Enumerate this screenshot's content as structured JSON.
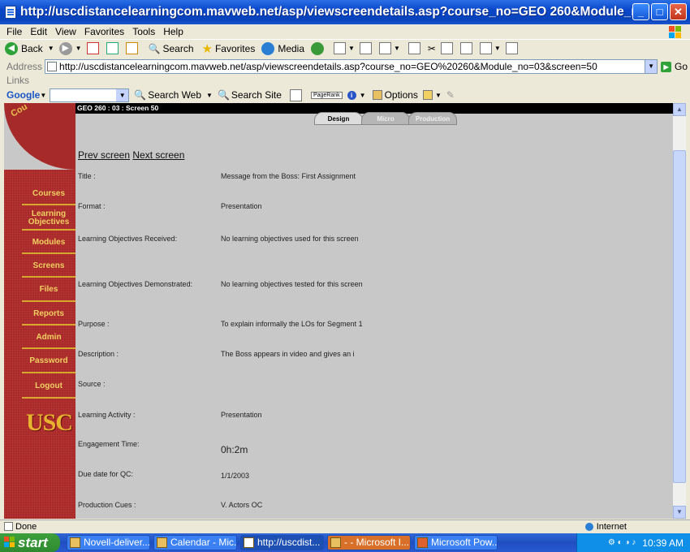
{
  "window": {
    "title": "http://uscdistancelearningcom.mavweb.net/asp/viewscreendetails.asp?course_no=GEO 260&Module_n...",
    "minimize": "_",
    "maximize": "□",
    "close": "✕"
  },
  "menu": [
    "File",
    "Edit",
    "View",
    "Favorites",
    "Tools",
    "Help"
  ],
  "toolbar": {
    "back": "Back",
    "search": "Search",
    "favorites": "Favorites",
    "media": "Media"
  },
  "address": {
    "label": "Address",
    "url": "http://uscdistancelearningcom.mavweb.net/asp/viewscreendetails.asp?course_no=GEO%20260&Module_no=03&screen=50",
    "go": "Go"
  },
  "links": "Links",
  "google": {
    "brand": "Google",
    "search_web": "Search Web",
    "search_site": "Search Site",
    "pagerank": "PageRank",
    "options": "Options"
  },
  "page": {
    "header": "GEO 260 : 03 : Screen 50",
    "corner_tag": "Cou",
    "tabs": [
      "Design",
      "Micro",
      "Production"
    ],
    "prev": "Prev screen",
    "next": "Next screen",
    "nav": [
      "Courses",
      "Learning Objectives",
      "Modules",
      "Screens",
      "Files",
      "Reports",
      "Admin",
      "Password",
      "Logout"
    ],
    "logo": "USC",
    "fields": [
      {
        "key": "Title :",
        "value": "Message from the Boss: First Assignment"
      },
      {
        "key": "Format :",
        "value": "Presentation"
      },
      {
        "key": "Learning Objectives Received:",
        "value": "No learning objectives used for this screen"
      },
      {
        "key": "Learning Objectives Demonstrated:",
        "value": "No learning objectives tested for this screen"
      },
      {
        "key": "Purpose :",
        "value": "To explain informally the LOs for Segment 1"
      },
      {
        "key": "Description :",
        "value": "The Boss appears in video and gives an i"
      },
      {
        "key": "Source :",
        "value": ""
      },
      {
        "key": "Learning Activity :",
        "value": "Presentation"
      },
      {
        "key": "Engagement Time:",
        "value": "0h:2m"
      },
      {
        "key": "Due date for QC:",
        "value": "1/1/2003"
      },
      {
        "key": "Production Cues :",
        "value": "V. Actors OC"
      }
    ]
  },
  "status": {
    "left": "Done",
    "zone": "Internet"
  },
  "taskbar": {
    "start": "start",
    "tasks": [
      "Novell-deliver...",
      "Calendar - Mic...",
      "http://uscdist...",
      "- - Microsoft I...",
      "Microsoft Pow..."
    ],
    "clock": "10:39 AM"
  },
  "colors": {
    "sidebar": "#a72a2a",
    "nav_text": "#f0d060",
    "page_bg": "#c8c8c8",
    "xp_blue": "#0a47c9"
  }
}
